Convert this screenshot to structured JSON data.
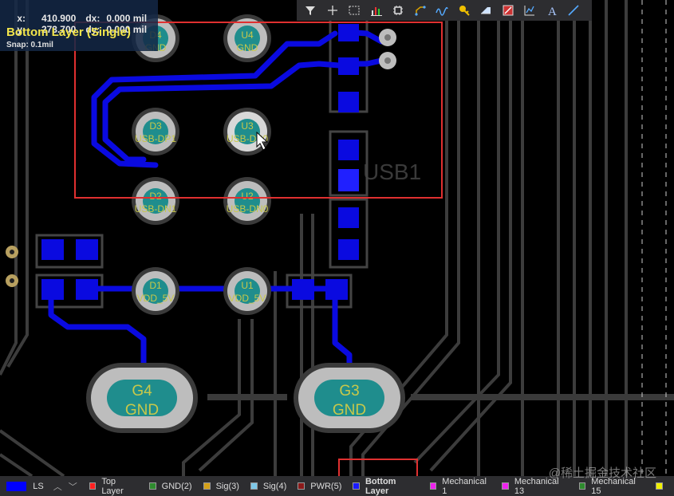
{
  "hud": {
    "x_label": "x:",
    "x_value": "410.900",
    "dx_label": "dx:",
    "dx_value": "0.000 mil",
    "y_label": "y:",
    "y_value": "273.700",
    "dy_label": "dy:",
    "dy_value": "0.000 mil",
    "layer_title": "Bottom Layer (Single)",
    "snap": "Snap: 0.1mil"
  },
  "toolbar": {
    "icons": [
      "filter-icon",
      "cross-icon",
      "select-rect-icon",
      "bar-chart-icon",
      "component-icon",
      "route-icon",
      "wave-icon",
      "key-icon",
      "fill-icon",
      "region-icon",
      "graph-icon",
      "text-icon",
      "line-icon"
    ]
  },
  "pads": {
    "top_left_1": {
      "label": "D4",
      "net": "GND"
    },
    "top_left_2": {
      "label": "U4",
      "net": "GND"
    },
    "d3": {
      "label": "D3",
      "net": "USB-DP1"
    },
    "u3": {
      "label": "U3",
      "net": "USB-DP0"
    },
    "d2": {
      "label": "D2",
      "net": "USB-DN1"
    },
    "u2": {
      "label": "U2",
      "net": "USB-DN0"
    },
    "d1": {
      "label": "D1",
      "net": "VDD_5V"
    },
    "u1": {
      "label": "U1",
      "net": "VDD_5V"
    },
    "g4": {
      "label": "G4",
      "net": "GND"
    },
    "g3": {
      "label": "G3",
      "net": "GND"
    }
  },
  "silkscreen": {
    "usb_label": "USB1"
  },
  "statusbar": {
    "ls_label": "LS",
    "layers": [
      {
        "name": "Top Layer",
        "color": "#ff2020"
      },
      {
        "name": "GND(2)",
        "color": "#2e8b2e"
      },
      {
        "name": "Sig(3)",
        "color": "#d4a017"
      },
      {
        "name": "Sig(4)",
        "color": "#7ec8e8"
      },
      {
        "name": "PWR(5)",
        "color": "#8b1a1a"
      },
      {
        "name": "Bottom Layer",
        "color": "#1a1aff",
        "active": true
      },
      {
        "name": "Mechanical 1",
        "color": "#ee22ee"
      },
      {
        "name": "Mechanical 13",
        "color": "#ee22ee"
      },
      {
        "name": "Mechanical 15",
        "color": "#2e8b2e"
      },
      {
        "name": "",
        "color": "#f0f000"
      }
    ]
  },
  "watermark": "@稀土掘金技术社区",
  "colors": {
    "trace": "#0a0ae0",
    "pad_copper": "#0a0ae0",
    "via_ring": "#bdbdbd",
    "via_hole": "#1f8d8d",
    "outline": "#3a3a3a",
    "highlight": "#e03030"
  }
}
